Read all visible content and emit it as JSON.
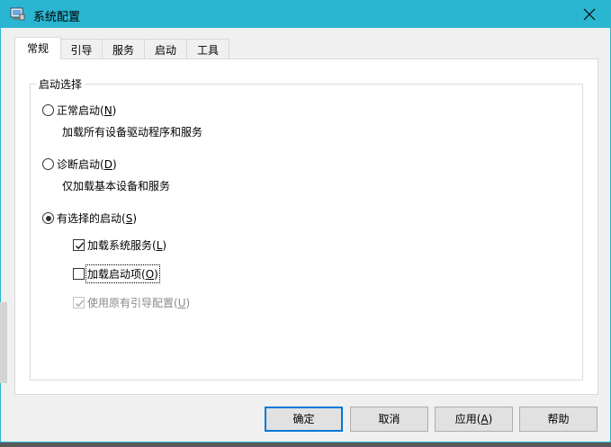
{
  "window": {
    "title": "系统配置",
    "close_icon": "close-icon",
    "titlebar_color": "#2ab5d1"
  },
  "tabs": [
    {
      "label": "常规",
      "active": true
    },
    {
      "label": "引导",
      "active": false
    },
    {
      "label": "服务",
      "active": false
    },
    {
      "label": "启动",
      "active": false
    },
    {
      "label": "工具",
      "active": false
    }
  ],
  "group": {
    "label": "启动选择"
  },
  "options": {
    "normal": {
      "label": "正常启动(",
      "key": "N",
      "suffix": ")",
      "desc": "加载所有设备驱动程序和服务",
      "checked": false
    },
    "diagnostic": {
      "label": "诊断启动(",
      "key": "D",
      "suffix": ")",
      "desc": "仅加载基本设备和服务",
      "checked": false
    },
    "selective": {
      "label": "有选择的启动(",
      "key": "S",
      "suffix": ")",
      "checked": true
    }
  },
  "checks": {
    "system_services": {
      "label": "加载系统服务(",
      "key": "L",
      "suffix": ")",
      "checked": true
    },
    "startup_items": {
      "label": "加载启动项(",
      "key": "O",
      "suffix": ")",
      "checked": false
    },
    "original_boot": {
      "label": "使用原有引导配置(",
      "key": "U",
      "suffix": ")",
      "checked": true,
      "disabled": true
    }
  },
  "buttons": {
    "ok": "确定",
    "cancel": "取消",
    "apply_label": "应用(",
    "apply_key": "A",
    "apply_suffix": ")",
    "help": "帮助"
  },
  "colors": {
    "accent": "#0078d7"
  }
}
